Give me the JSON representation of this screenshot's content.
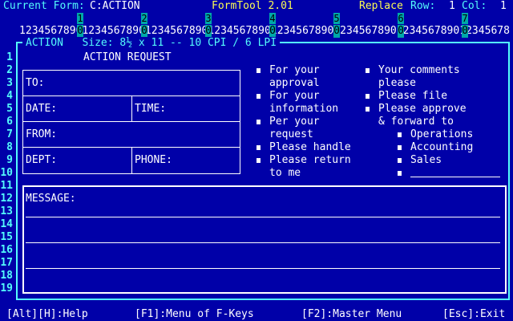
{
  "status": {
    "current_form_label": "Current Form:",
    "current_form_value": "C:ACTION",
    "app_name": "FormTool 2.01",
    "mode": "Replace",
    "row_label": "Row:",
    "row_value": "1",
    "col_label": "Col:",
    "col_value": "1"
  },
  "ruler": {
    "tens": [
      "1",
      "2",
      "3",
      "4",
      "5",
      "6",
      "7"
    ],
    "line": "123456789012345678901234567890123456789012345678901234567890123456789012345678"
  },
  "frame": {
    "title": "ACTION   Size: 8½ x 11 -- 10 CPI / 6 LPI"
  },
  "line_numbers": [
    "1",
    "2",
    "3",
    "4",
    "5",
    "6",
    "7",
    "8",
    "9",
    "10",
    "11",
    "12",
    "13",
    "14",
    "15",
    "16",
    "17",
    "18",
    "19"
  ],
  "form": {
    "heading": "ACTION REQUEST",
    "to_label": "TO:",
    "date_label": "DATE:",
    "time_label": "TIME:",
    "from_label": "FROM:",
    "dept_label": "DEPT:",
    "phone_label": "PHONE:",
    "message_label": "MESSAGE:",
    "left_options": [
      {
        "line1": "For your",
        "line2": "approval"
      },
      {
        "line1": "For your",
        "line2": "information"
      },
      {
        "line1": "Per your",
        "line2": "request"
      },
      {
        "line1": "Please handle",
        "line2": ""
      },
      {
        "line1": "Please return",
        "line2": "to me"
      }
    ],
    "right_options": [
      {
        "line1": "Your comments",
        "line2": "please"
      },
      {
        "line1": "Please file",
        "line2": ""
      },
      {
        "line1": "Please approve",
        "line2": "& forward to"
      }
    ],
    "forward_to": [
      "Operations",
      "Accounting",
      "Sales",
      ""
    ]
  },
  "bottom": {
    "help": "[Alt][H]:Help",
    "menu": "[F1]:Menu of F-Keys",
    "master": "[F2]:Master Menu",
    "exit": "[Esc]:Exit"
  }
}
